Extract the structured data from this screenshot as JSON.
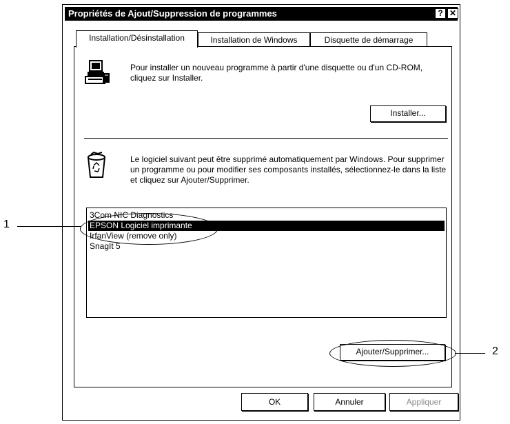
{
  "window": {
    "title": "Propriétés de Ajout/Suppression de programmes",
    "help_glyph": "?",
    "close_glyph": "✕"
  },
  "tabs": [
    {
      "label": "Installation/Désinstallation",
      "active": true
    },
    {
      "label": "Installation de Windows",
      "active": false
    },
    {
      "label": "Disquette de démarrage",
      "active": false
    }
  ],
  "install": {
    "icon": "computer-install-icon",
    "description": "Pour installer un nouveau programme à partir d'une disquette ou d'un CD-ROM, cliquez sur Installer.",
    "button_label": "Installer..."
  },
  "uninstall": {
    "icon": "recycle-bin-icon",
    "description": "Le logiciel suivant peut être supprimé automatiquement par Windows. Pour supprimer un programme ou pour modifier ses composants installés, sélectionnez-le dans la liste et cliquez sur Ajouter/Supprimer.",
    "programs": [
      {
        "name": "3Com NIC Diagnostics",
        "selected": false
      },
      {
        "name": "EPSON Logiciel imprimante",
        "selected": true
      },
      {
        "name": "IrfanView (remove only)",
        "selected": false
      },
      {
        "name": "SnagIt 5",
        "selected": false
      }
    ],
    "button_label": "Ajouter/Supprimer..."
  },
  "footer": {
    "ok_label": "OK",
    "cancel_label": "Annuler",
    "apply_label": "Appliquer"
  },
  "callouts": {
    "one": "1",
    "two": "2"
  }
}
